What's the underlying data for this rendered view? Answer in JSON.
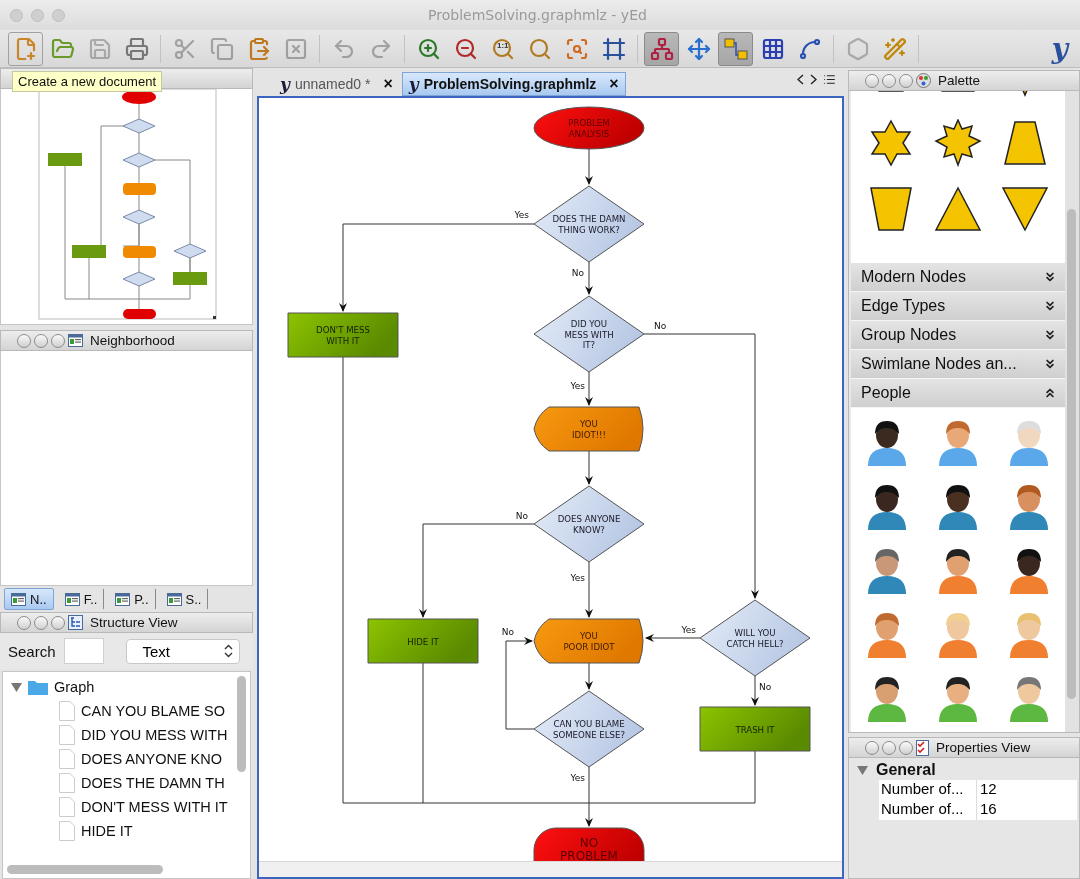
{
  "window": {
    "title": "ProblemSolving.graphmlz - yEd"
  },
  "toolbar": {
    "items": [
      {
        "selected": false,
        "disabled": false
      },
      {
        "selected": false,
        "disabled": false
      },
      {
        "selected": false,
        "disabled": true
      },
      {
        "selected": false,
        "disabled": false
      },
      {
        "selected": false,
        "disabled": true
      },
      {
        "selected": false,
        "disabled": true
      },
      {
        "selected": false,
        "disabled": false
      },
      {
        "selected": false,
        "disabled": true
      },
      {
        "selected": false,
        "disabled": true
      },
      {
        "selected": false,
        "disabled": true
      },
      {
        "selected": false,
        "disabled": false
      },
      {
        "selected": false,
        "disabled": false
      },
      {
        "selected": false,
        "disabled": false,
        "label": "1:1"
      },
      {
        "selected": false,
        "disabled": false
      },
      {
        "selected": false,
        "disabled": false
      },
      {
        "selected": false,
        "disabled": false
      },
      {
        "selected": true,
        "disabled": false
      },
      {
        "selected": false,
        "disabled": false
      },
      {
        "selected": true,
        "disabled": false
      },
      {
        "selected": false,
        "disabled": false
      },
      {
        "selected": false,
        "disabled": false
      },
      {
        "selected": false,
        "disabled": true
      },
      {
        "selected": false,
        "disabled": false
      }
    ],
    "logo": "y"
  },
  "tooltip": {
    "text": "Create a new document"
  },
  "neighborhood": {
    "title": "Neighborhood"
  },
  "dock_tabs": [
    {
      "label": "N..",
      "selected": true
    },
    {
      "label": "F..",
      "selected": false
    },
    {
      "label": "P..",
      "selected": false
    },
    {
      "label": "S..",
      "selected": false
    }
  ],
  "structure_view": {
    "title": "Structure View",
    "search_label": "Search",
    "filter": "Text",
    "tree": [
      {
        "label": "Graph",
        "expanded": true,
        "children": [
          {
            "label": "CAN YOU BLAME SO"
          },
          {
            "label": "DID YOU MESS WITH"
          },
          {
            "label": "DOES ANYONE KNO"
          },
          {
            "label": "DOES THE DAMN TH"
          },
          {
            "label": "DON'T MESS WITH IT"
          },
          {
            "label": "HIDE IT"
          }
        ]
      }
    ]
  },
  "document_tabs": [
    {
      "glyph": "y",
      "label": "unnamed0 *",
      "close": "×",
      "selected": false
    },
    {
      "glyph": "y",
      "label": "ProblemSolving.graphmlz",
      "close": "×",
      "selected": true
    }
  ],
  "diagram": {
    "nodes": [
      {
        "kind": "start",
        "lines": [
          "PROBLEM",
          "ANALYSIS"
        ]
      },
      {
        "kind": "decision",
        "lines": [
          "DOES THE DAMN",
          "THING WORK?"
        ]
      },
      {
        "kind": "process",
        "lines": [
          "DON'T MESS",
          "WITH IT"
        ]
      },
      {
        "kind": "decision",
        "lines": [
          "DID YOU",
          "MESS WITH",
          "IT?"
        ]
      },
      {
        "kind": "display",
        "lines": [
          "YOU",
          "IDIOT!!!"
        ]
      },
      {
        "kind": "decision",
        "lines": [
          "DOES ANYONE",
          "KNOW?"
        ]
      },
      {
        "kind": "process",
        "lines": [
          "HIDE IT"
        ]
      },
      {
        "kind": "display",
        "lines": [
          "YOU",
          "POOR IDIOT"
        ]
      },
      {
        "kind": "decision",
        "lines": [
          "WILL YOU",
          "CATCH HELL?"
        ]
      },
      {
        "kind": "decision",
        "lines": [
          "CAN YOU BLAME",
          "SOMEONE ELSE?"
        ]
      },
      {
        "kind": "process",
        "lines": [
          "TRASH IT"
        ]
      },
      {
        "kind": "end",
        "lines": [
          "NO",
          "PROBLEM"
        ]
      }
    ],
    "edges": [
      {
        "label": "Yes"
      },
      {
        "label": "No"
      },
      {
        "label": "No"
      },
      {
        "label": "Yes"
      },
      {
        "label": "No"
      },
      {
        "label": "Yes"
      },
      {
        "label": "Yes"
      },
      {
        "label": "No"
      },
      {
        "label": "No"
      },
      {
        "label": "Yes"
      }
    ]
  },
  "palette": {
    "title": "Palette",
    "sections": [
      {
        "label": "Modern Nodes",
        "expanded": false
      },
      {
        "label": "Edge Types",
        "expanded": false
      },
      {
        "label": "Group Nodes",
        "expanded": false
      },
      {
        "label": "Swimlane Nodes an...",
        "expanded": false
      },
      {
        "label": "People",
        "expanded": true
      }
    ]
  },
  "properties": {
    "title": "Properties View",
    "group": {
      "label": "General",
      "expanded": true
    },
    "rows": [
      {
        "name": "Number of...",
        "value": "12"
      },
      {
        "name": "Number of...",
        "value": "16"
      }
    ]
  }
}
